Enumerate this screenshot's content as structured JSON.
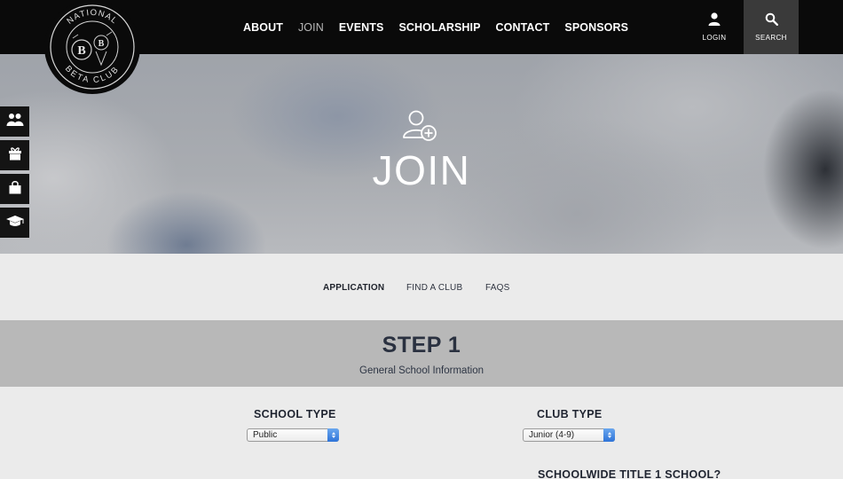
{
  "header": {
    "logo_text_top": "NATIONAL",
    "logo_text_bottom": "BETA CLUB",
    "nav": [
      "ABOUT",
      "JOIN",
      "EVENTS",
      "SCHOLARSHIP",
      "CONTACT",
      "SPONSORS"
    ],
    "active_nav": "JOIN",
    "login_label": "LOGIN",
    "search_label": "SEARCH"
  },
  "hero": {
    "icon": "user-add-icon",
    "title": "JOIN"
  },
  "dock": {
    "icons": [
      "group-icon",
      "gift-icon",
      "shopping-bag-icon",
      "graduation-cap-icon"
    ]
  },
  "subnav": {
    "items": [
      "APPLICATION",
      "FIND A CLUB",
      "FAQS"
    ],
    "active": "APPLICATION"
  },
  "step": {
    "title": "STEP 1",
    "subtitle": "General School Information"
  },
  "form": {
    "school_type": {
      "label": "SCHOOL TYPE",
      "value": "Public"
    },
    "club_type": {
      "label": "CLUB TYPE",
      "value": "Junior (4-9)"
    },
    "title1": {
      "label": "SCHOOLWIDE TITLE 1 SCHOOL?"
    }
  },
  "colors": {
    "topbar": "#0a0a0a",
    "search_bg": "#3a3a3a",
    "step_banner": "#b8b8b8",
    "heading_text": "#2a3140",
    "select_arrow": "#2f74d8"
  }
}
